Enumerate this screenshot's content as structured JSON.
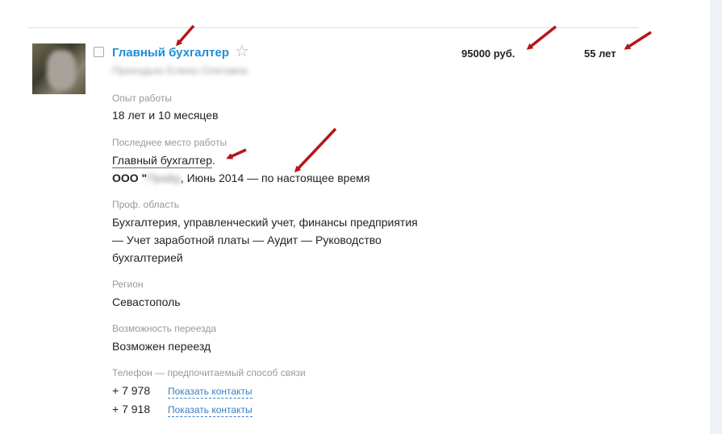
{
  "resume": {
    "title": "Главный бухгалтер",
    "candidate_name": "Приходько Елена Олеговна",
    "salary": "95000 руб.",
    "age": "55 лет"
  },
  "experience": {
    "label": "Опыт работы",
    "value": "18 лет и 10 месяцев"
  },
  "last_job": {
    "label": "Последнее место работы",
    "position": "Главный бухгалтер",
    "company_prefix": "ООО \"",
    "company_blurred": "Прайд",
    "period": ", Июнь 2014 — по настоящее время"
  },
  "prof_area": {
    "label": "Проф. область",
    "lines": [
      "Бухгалтерия, управленческий учет, финансы предприятия",
      "— Учет заработной платы — Аудит — Руководство",
      "бухгалтерией"
    ]
  },
  "region": {
    "label": "Регион",
    "value": "Севастополь"
  },
  "relocation": {
    "label": "Возможность переезда",
    "value": "Возможен переезд"
  },
  "phones": {
    "label": "Телефон — предпочитаемый способ связи",
    "items": [
      {
        "number": "+ 7 978",
        "link": "Показать контакты"
      },
      {
        "number": "+ 7 918",
        "link": "Показать контакты"
      }
    ]
  },
  "colors": {
    "title": "#1e8dd6",
    "link": "#3b7ec4",
    "arrow": "#b3171b"
  },
  "icons": [
    "star-icon",
    "arrow-icon"
  ]
}
